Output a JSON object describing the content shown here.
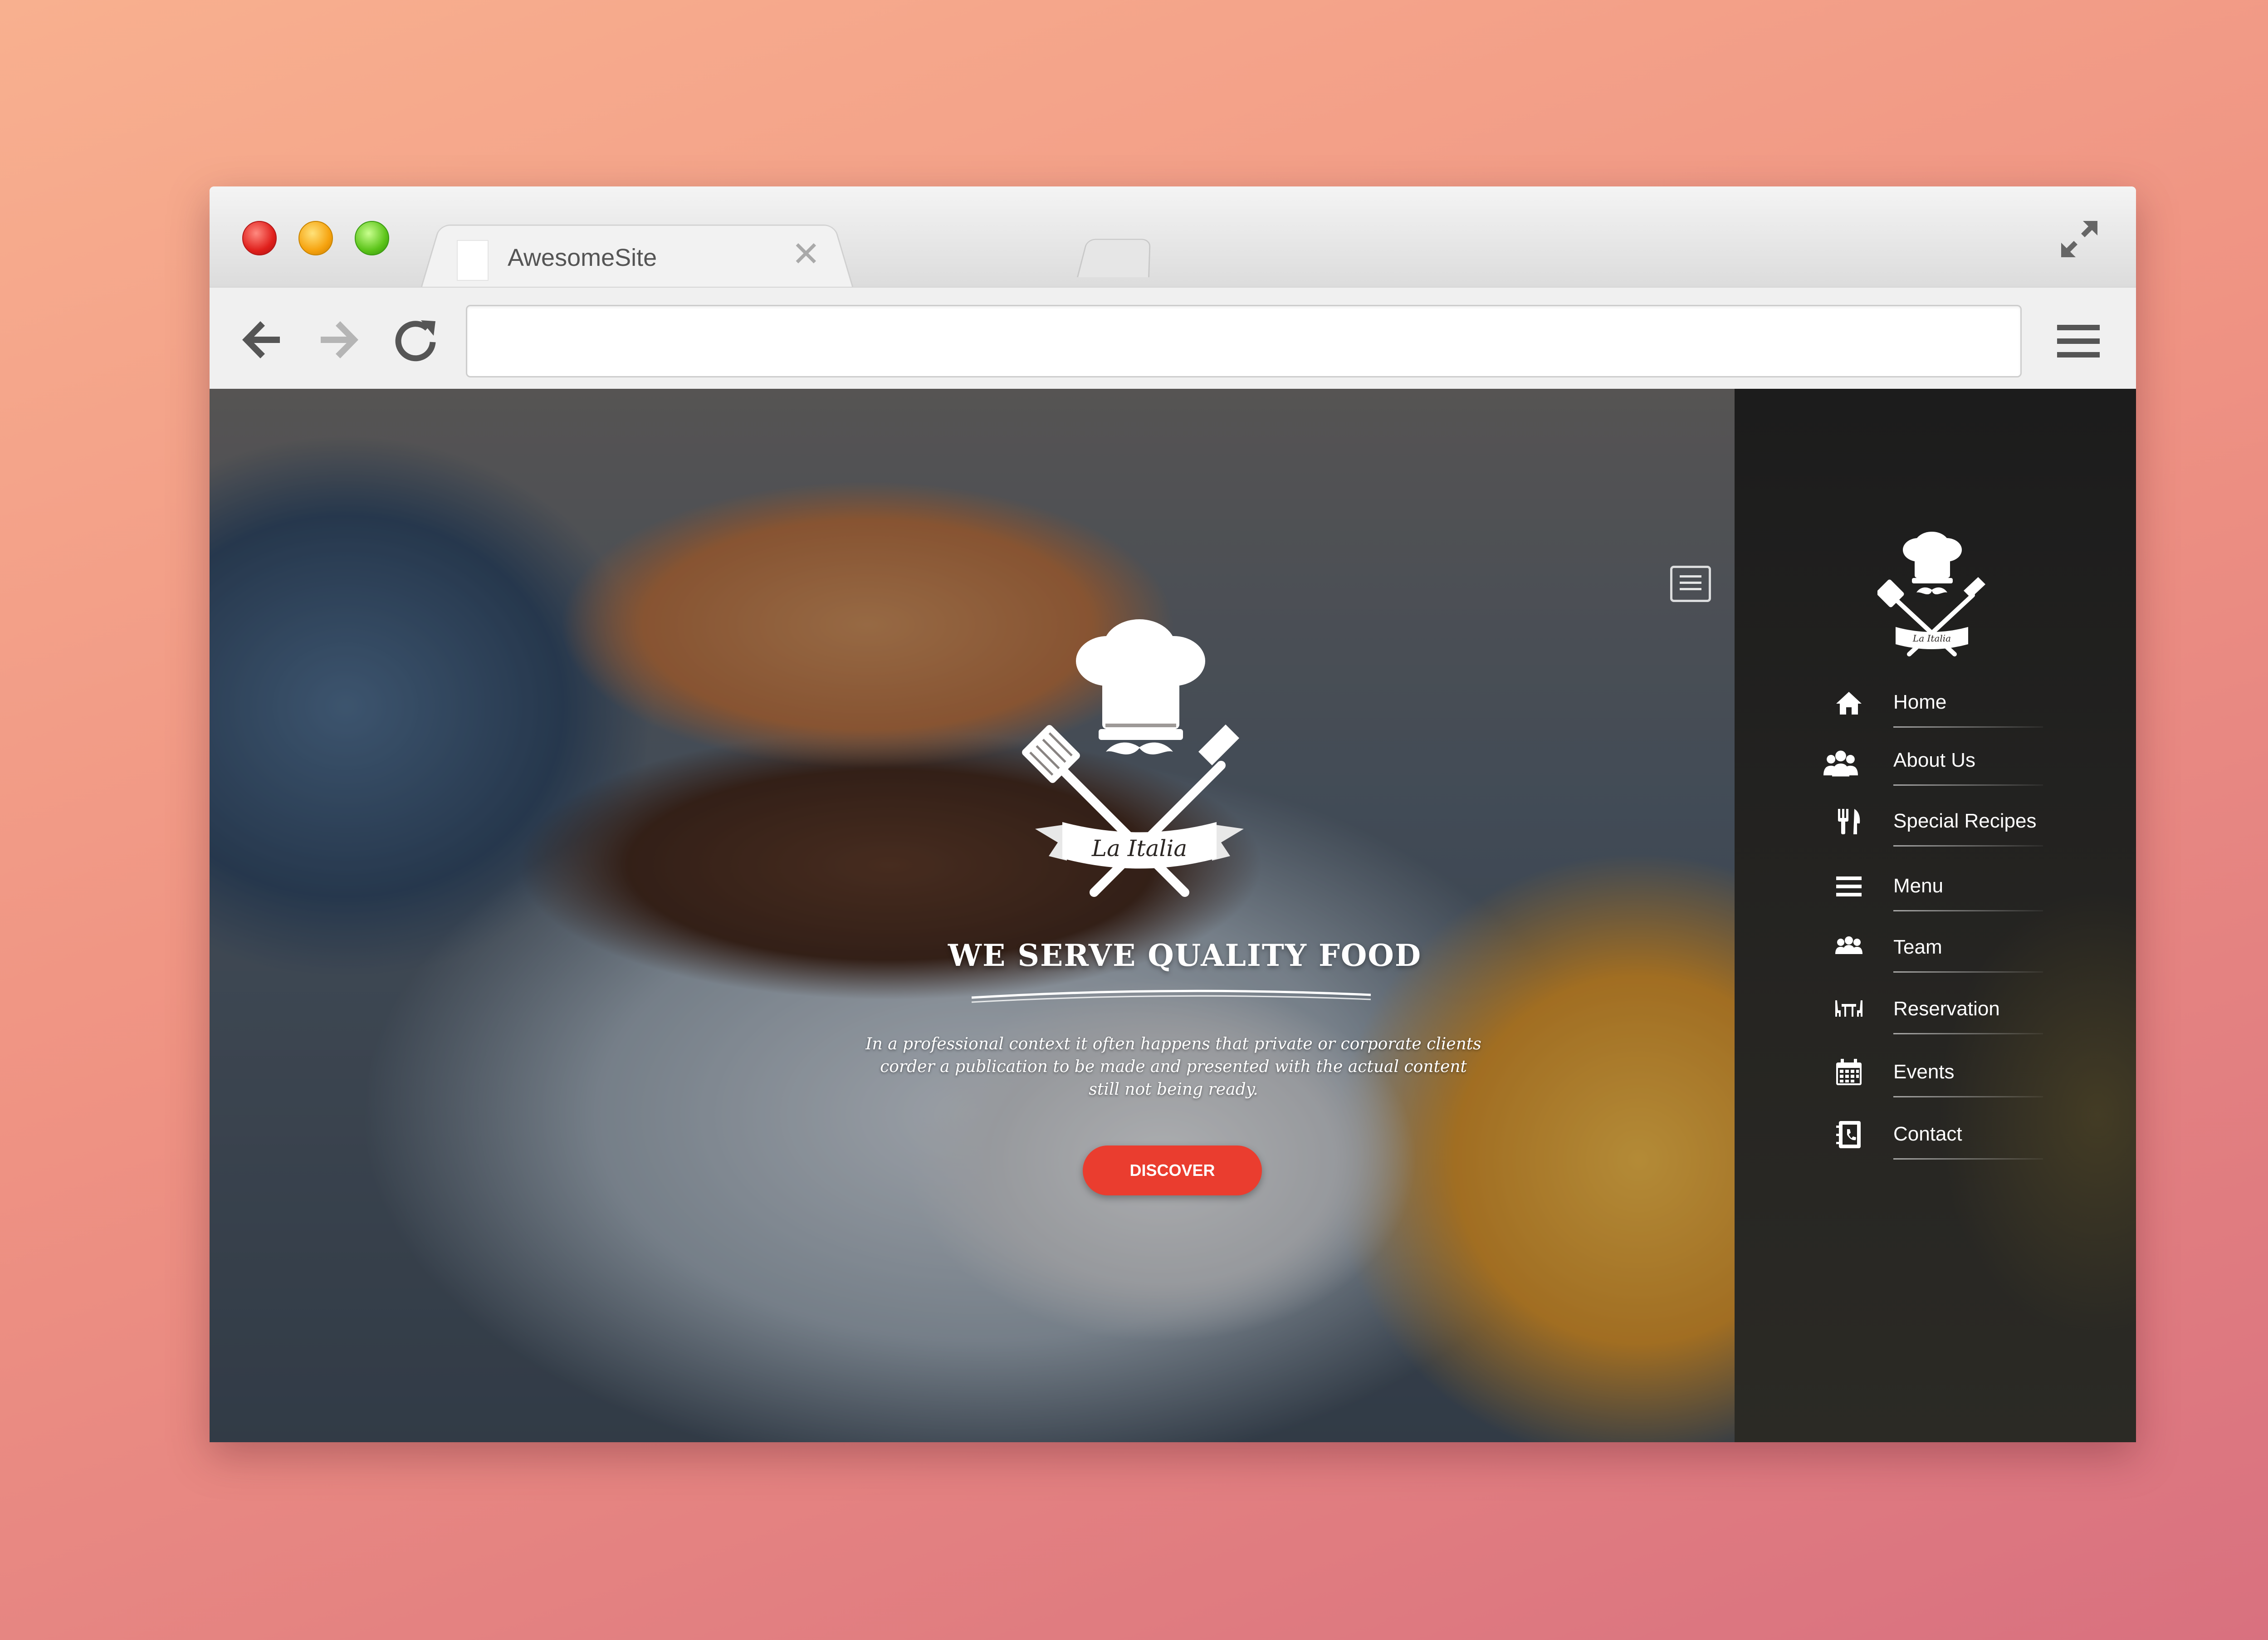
{
  "browser": {
    "tab_title": "AwesomeSite",
    "tab_close": "✕",
    "url": ""
  },
  "site": {
    "heading": "WE SERVE QUALITY FOOD",
    "logo_text": "La Italia",
    "intro": "In a professional context it often happens that private or corporate clients corder a publication to be made and presented with the actual content still not being ready.",
    "cta_label": "DISCOVER",
    "accent_color": "#ea3d2f"
  },
  "sidebar": {
    "items": [
      {
        "label": "Home",
        "icon": "home-icon"
      },
      {
        "label": "About Us",
        "icon": "users-icon"
      },
      {
        "label": "Special Recipes",
        "icon": "cutlery-icon"
      },
      {
        "label": "Menu",
        "icon": "menu-lines-icon"
      },
      {
        "label": "Team",
        "icon": "team-icon"
      },
      {
        "label": "Reservation",
        "icon": "table-icon"
      },
      {
        "label": "Events",
        "icon": "calendar-icon"
      },
      {
        "label": "Contact",
        "icon": "contact-book-icon"
      }
    ]
  }
}
